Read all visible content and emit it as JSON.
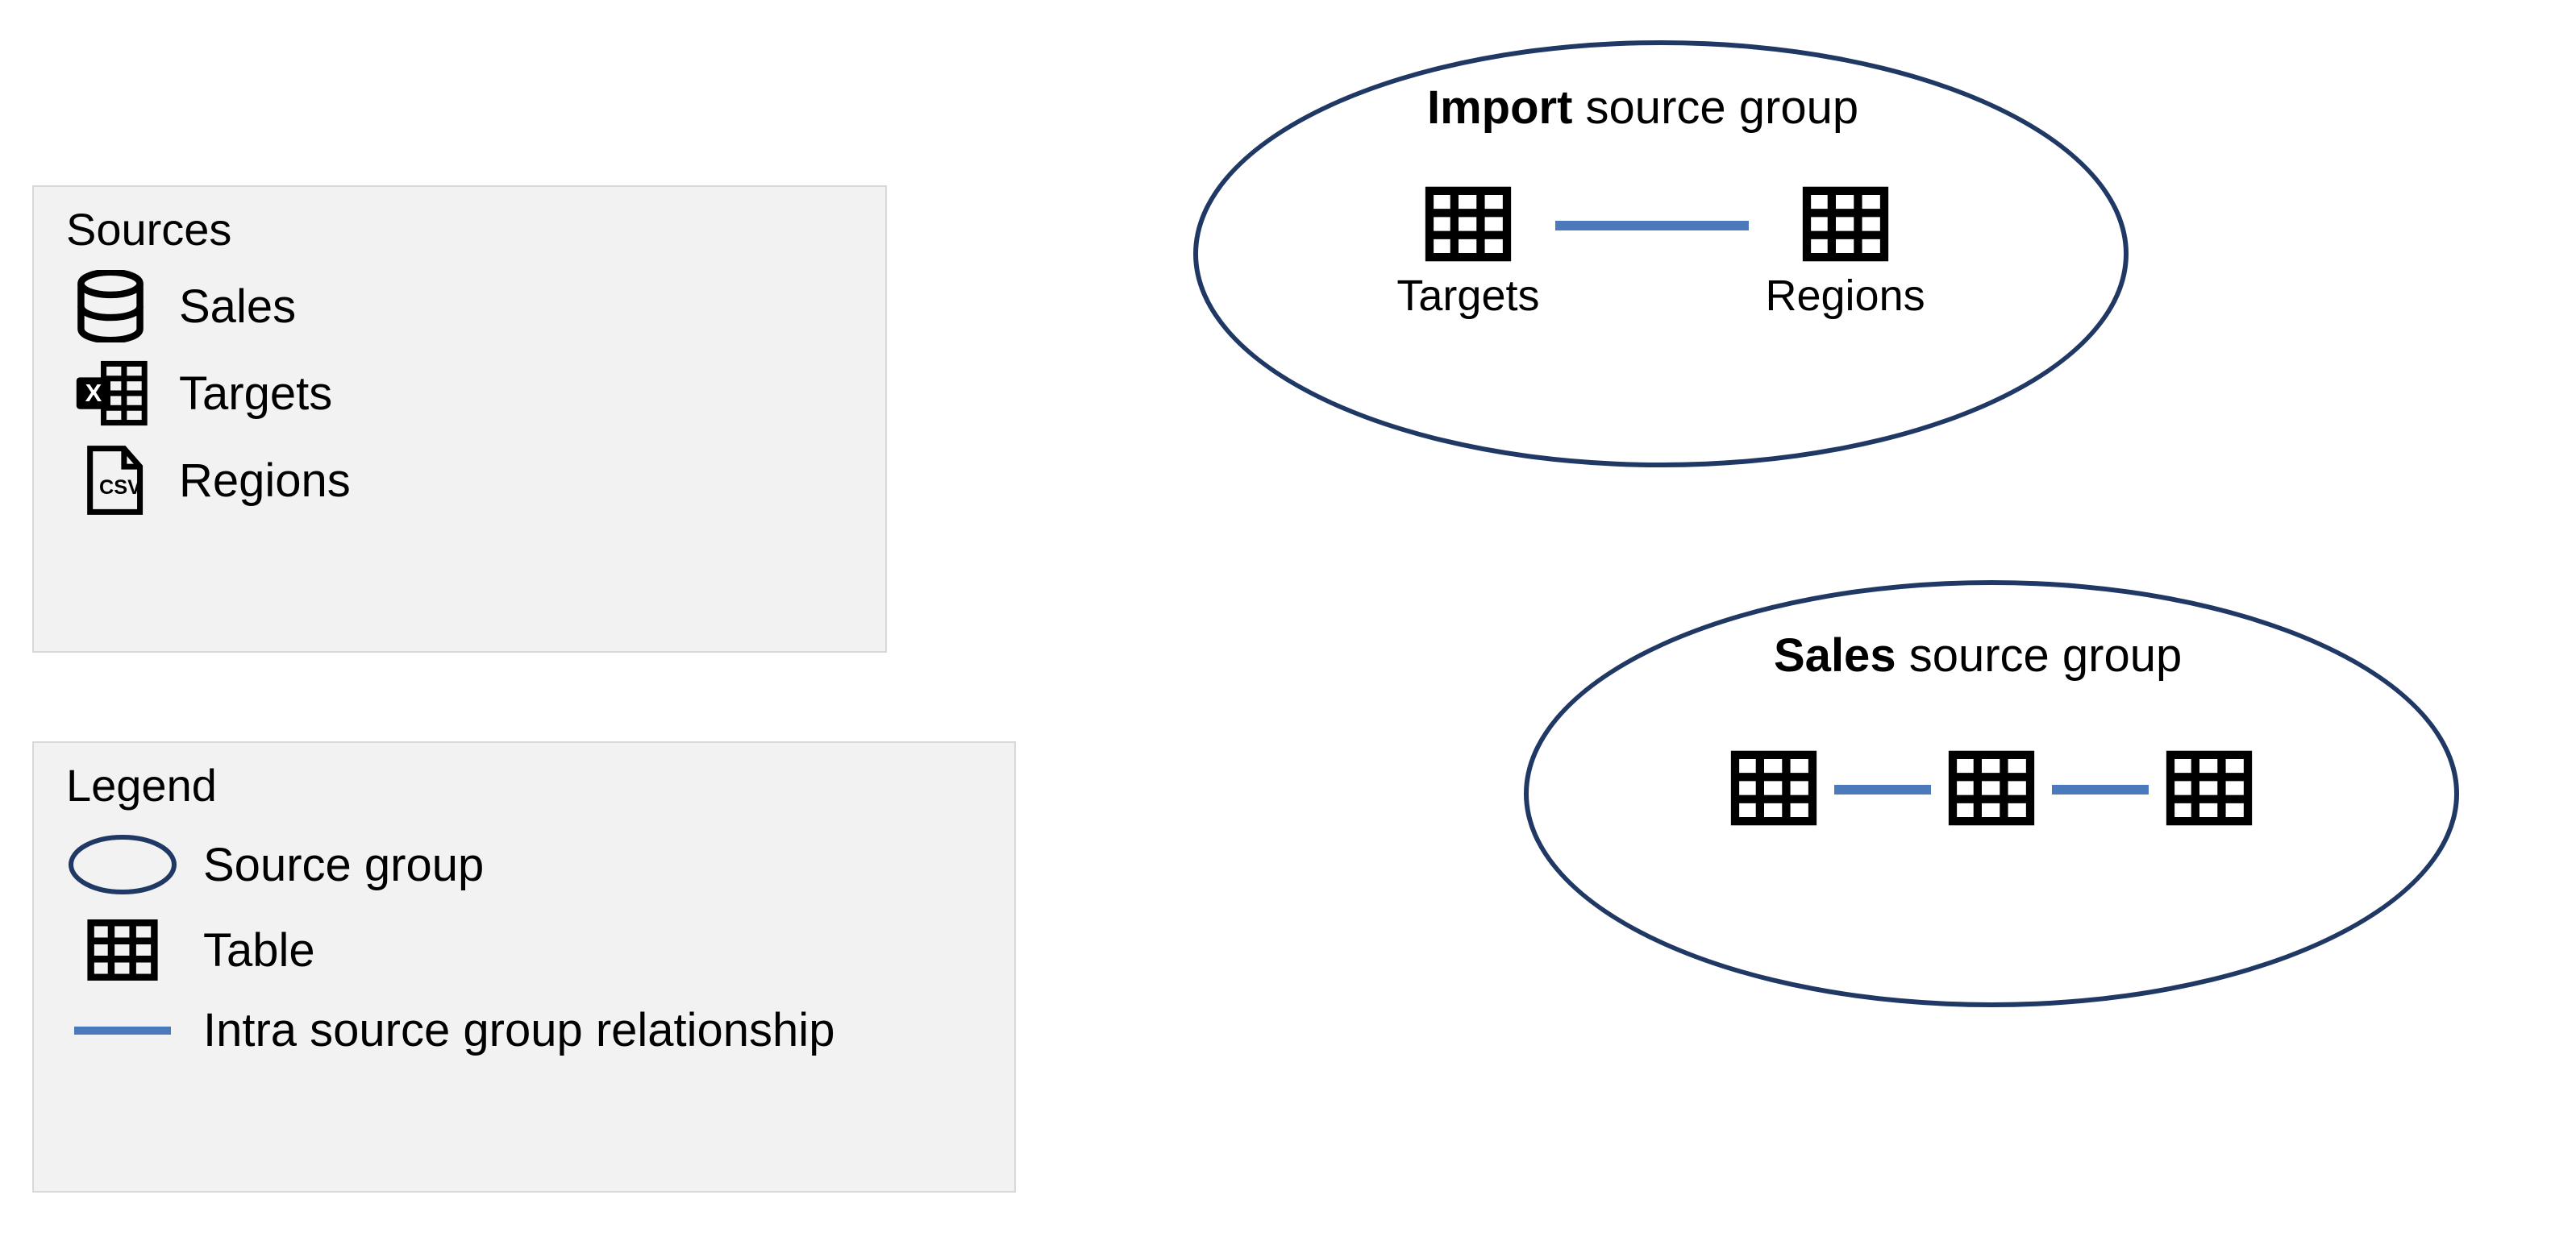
{
  "sources": {
    "title": "Sources",
    "items": [
      {
        "icon": "database",
        "label": "Sales"
      },
      {
        "icon": "excel",
        "label": "Targets"
      },
      {
        "icon": "csv",
        "label": "Regions"
      }
    ]
  },
  "legend": {
    "title": "Legend",
    "items": [
      {
        "icon": "ellipse",
        "label": "Source group"
      },
      {
        "icon": "table",
        "label": "Table"
      },
      {
        "icon": "line",
        "label": "Intra source group relationship"
      }
    ]
  },
  "groups": {
    "import": {
      "title_bold": "Import",
      "title_rest": " source group",
      "tables": [
        {
          "label": "Targets"
        },
        {
          "label": "Regions"
        }
      ]
    },
    "sales": {
      "title_bold": "Sales",
      "title_rest": " source group",
      "tables": [
        {
          "label": ""
        },
        {
          "label": ""
        },
        {
          "label": ""
        }
      ]
    }
  },
  "colors": {
    "ellipse_border": "#203864",
    "rel_line": "#4a7abc",
    "panel_bg": "#f2f2f2"
  }
}
